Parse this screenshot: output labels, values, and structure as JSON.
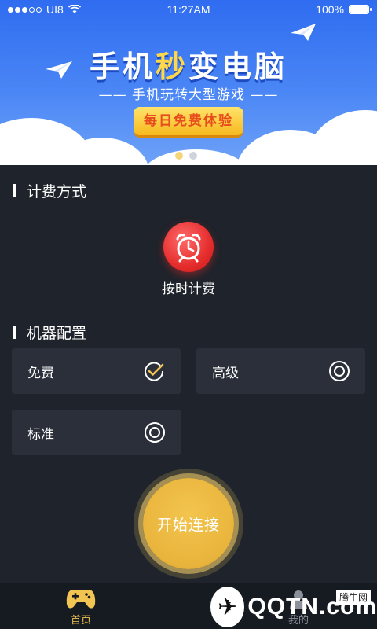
{
  "status_bar": {
    "carrier": "UI8",
    "time": "11:27AM",
    "battery": "100%"
  },
  "banner": {
    "title_part1": "手机",
    "title_highlight": "秒",
    "title_part2": "变电脑",
    "subtitle": "—— 手机玩转大型游戏 ——",
    "button": "每日免费体验"
  },
  "billing": {
    "section_title": "计费方式",
    "method_label": "按时计费"
  },
  "machine": {
    "section_title": "机器配置",
    "options": [
      {
        "label": "免费",
        "state": "checked"
      },
      {
        "label": "高级",
        "state": "radio"
      },
      {
        "label": "标准",
        "state": "radio"
      }
    ]
  },
  "connect_button": "开始连接",
  "tabs": {
    "home": "首页",
    "me": "我的"
  },
  "watermark": {
    "brand": "QQTN.com",
    "tag": "腾牛网"
  },
  "colors": {
    "accent": "#f2c553",
    "banner_blue": "#3a78f2",
    "alarm_red": "#e52d2d",
    "background": "#1f232b",
    "card": "#2a2f39"
  }
}
